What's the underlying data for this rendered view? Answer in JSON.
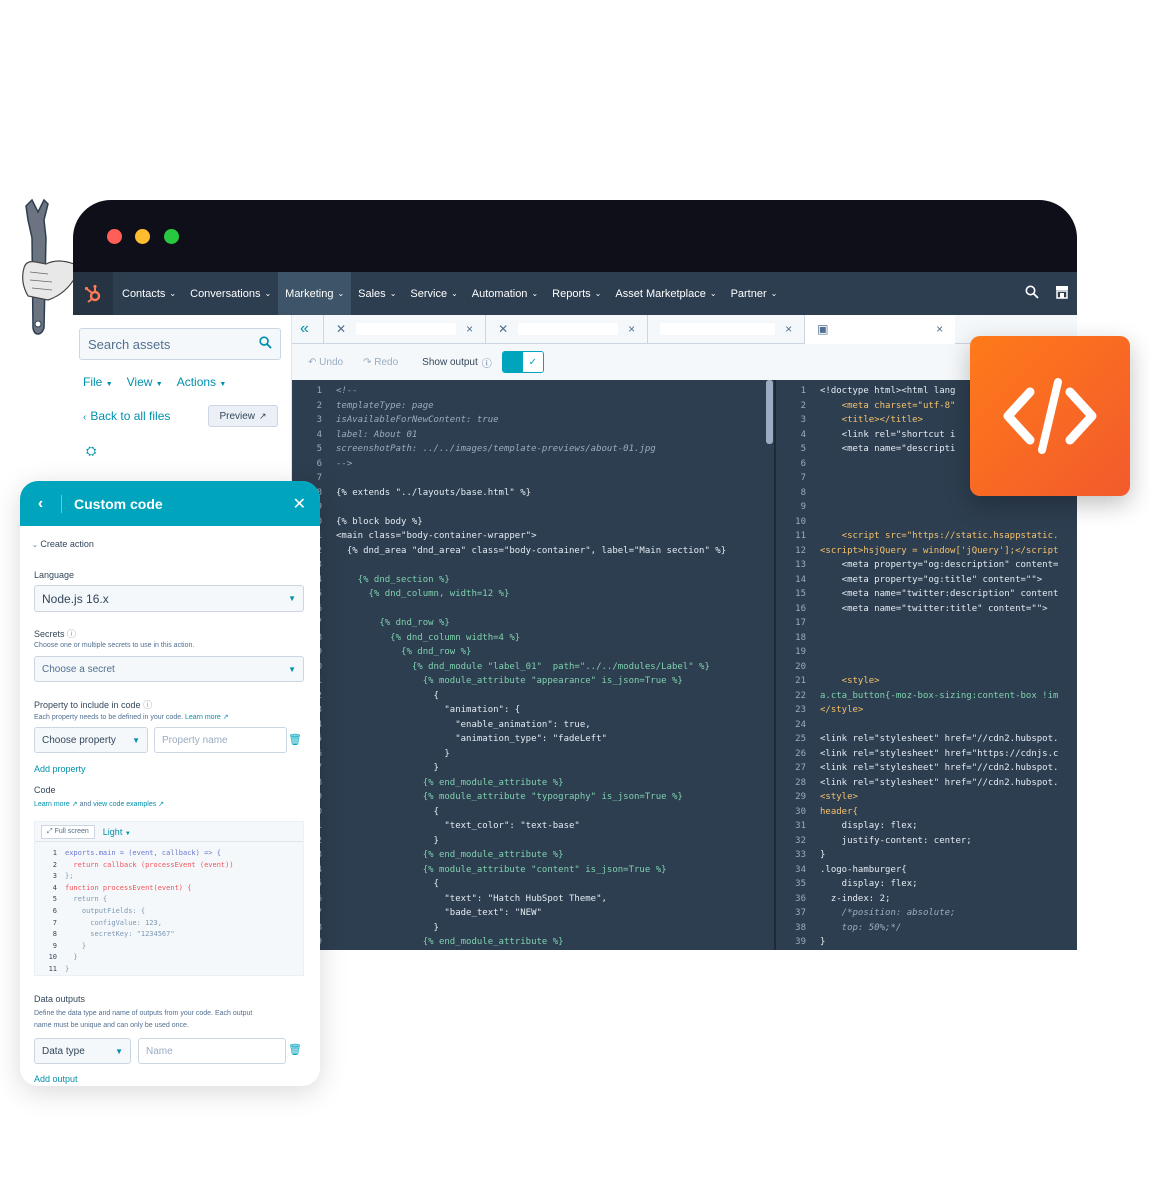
{
  "nav": {
    "items": [
      "Contacts",
      "Conversations",
      "Marketing",
      "Sales",
      "Service",
      "Automation",
      "Reports",
      "Asset Marketplace",
      "Partner"
    ],
    "active": "Marketing",
    "icons": [
      "sprocket-logo-icon",
      "search-icon",
      "marketplace-icon"
    ]
  },
  "assets": {
    "search_placeholder": "Search assets",
    "menus": [
      "File",
      "View",
      "Actions"
    ],
    "back_link": "Back to all files",
    "preview": "Preview"
  },
  "toolbar": {
    "undo": "Undo",
    "redo": "Redo",
    "show_output": "Show output"
  },
  "code_left": [
    {
      "n": "1",
      "t": "<!--",
      "c": "#99acc2",
      "i": true
    },
    {
      "n": "2",
      "t": "templateType: page",
      "c": "#99acc2",
      "i": true
    },
    {
      "n": "3",
      "t": "isAvailableForNewContent: true",
      "c": "#99acc2",
      "i": true
    },
    {
      "n": "4",
      "t": "label: About 01",
      "c": "#99acc2",
      "i": true
    },
    {
      "n": "5",
      "t": "screenshotPath: ../../images/template-previews/about-01.jpg",
      "c": "#99acc2",
      "i": true
    },
    {
      "n": "6",
      "t": "-->",
      "c": "#99acc2",
      "i": true
    },
    {
      "n": "7",
      "t": "",
      "c": "#e4ebf2"
    },
    {
      "n": "8",
      "t": "{% extends \"../layouts/base.html\" %}",
      "c": "#e4ebf2"
    },
    {
      "n": "9",
      "t": "",
      "c": "#e4ebf2"
    },
    {
      "n": "10",
      "t": "{% block body %}",
      "c": "#e4ebf2"
    },
    {
      "n": "11",
      "t": "<main class=\"body-container-wrapper\">",
      "c": "#e4ebf2"
    },
    {
      "n": "12",
      "t": "  {% dnd_area \"dnd_area\" class=\"body-container\", label=\"Main section\" %}",
      "c": "#e4ebf2"
    },
    {
      "n": "13",
      "t": "",
      "c": "#e4ebf2"
    },
    {
      "n": "14",
      "t": "    {% dnd_section %}",
      "c": "#7fd1ae"
    },
    {
      "n": "15",
      "t": "      {% dnd_column, width=12 %}",
      "c": "#7fd1ae"
    },
    {
      "n": "16",
      "t": "",
      "c": "#e4ebf2"
    },
    {
      "n": "17",
      "t": "        {% dnd_row %}",
      "c": "#7fd1ae"
    },
    {
      "n": "18",
      "t": "          {% dnd_column width=4 %}",
      "c": "#7fd1ae"
    },
    {
      "n": "19",
      "t": "            {% dnd_row %}",
      "c": "#7fd1ae"
    },
    {
      "n": "20",
      "t": "              {% dnd_module \"label_01\"  path=\"../../modules/Label\" %}",
      "c": "#7fd1ae"
    },
    {
      "n": "21",
      "t": "                {% module_attribute \"appearance\" is_json=True %}",
      "c": "#7fd1ae"
    },
    {
      "n": "22",
      "t": "                  {",
      "c": "#e4ebf2"
    },
    {
      "n": "23",
      "t": "                    \"animation\": {",
      "c": "#e4ebf2"
    },
    {
      "n": "24",
      "t": "                      \"enable_animation\": true,",
      "c": "#e4ebf2"
    },
    {
      "n": "25",
      "t": "                      \"animation_type\": \"fadeLeft\"",
      "c": "#e4ebf2"
    },
    {
      "n": "26",
      "t": "                    }",
      "c": "#e4ebf2"
    },
    {
      "n": "27",
      "t": "                  }",
      "c": "#e4ebf2"
    },
    {
      "n": "28",
      "t": "                {% end_module_attribute %}",
      "c": "#7fd1ae"
    },
    {
      "n": "29",
      "t": "                {% module_attribute \"typography\" is_json=True %}",
      "c": "#7fd1ae"
    },
    {
      "n": "30",
      "t": "                  {",
      "c": "#e4ebf2"
    },
    {
      "n": "31",
      "t": "                    \"text_color\": \"text-base\"",
      "c": "#e4ebf2"
    },
    {
      "n": "32",
      "t": "                  }",
      "c": "#e4ebf2"
    },
    {
      "n": "33",
      "t": "                {% end_module_attribute %}",
      "c": "#7fd1ae"
    },
    {
      "n": "34",
      "t": "                {% module_attribute \"content\" is_json=True %}",
      "c": "#7fd1ae"
    },
    {
      "n": "35",
      "t": "                  {",
      "c": "#e4ebf2"
    },
    {
      "n": "36",
      "t": "                    \"text\": \"Hatch HubSpot Theme\",",
      "c": "#e4ebf2"
    },
    {
      "n": "37",
      "t": "                    \"bade_text\": \"NEW\"",
      "c": "#e4ebf2"
    },
    {
      "n": "38",
      "t": "                  }",
      "c": "#e4ebf2"
    },
    {
      "n": "39",
      "t": "                {% end_module_attribute %}",
      "c": "#7fd1ae"
    }
  ],
  "code_right": [
    {
      "n": "1",
      "t": "<!doctype html><html lang",
      "c": "#e4ebf2"
    },
    {
      "n": "2",
      "t": "    <meta charset=\"utf-8\"",
      "c": "#f5c26b"
    },
    {
      "n": "3",
      "t": "    <title></title>",
      "c": "#f5c26b"
    },
    {
      "n": "4",
      "t": "    <link rel=\"shortcut i",
      "c": "#e4ebf2"
    },
    {
      "n": "5",
      "t": "    <meta name=\"descripti",
      "c": "#e4ebf2"
    },
    {
      "n": "6",
      "t": "",
      "c": "#e4ebf2"
    },
    {
      "n": "7",
      "t": "",
      "c": "#e4ebf2"
    },
    {
      "n": "8",
      "t": "",
      "c": "#e4ebf2"
    },
    {
      "n": "9",
      "t": "",
      "c": "#e4ebf2"
    },
    {
      "n": "10",
      "t": "",
      "c": "#e4ebf2"
    },
    {
      "n": "11",
      "t": "    <script src=\"https://static.hsappstatic.",
      "c": "#f5c26b"
    },
    {
      "n": "12",
      "t": "<script>hsjQuery = window['jQuery'];</script",
      "c": "#f5c26b"
    },
    {
      "n": "13",
      "t": "    <meta property=\"og:description\" content=",
      "c": "#e4ebf2"
    },
    {
      "n": "14",
      "t": "    <meta property=\"og:title\" content=\"\">",
      "c": "#e4ebf2"
    },
    {
      "n": "15",
      "t": "    <meta name=\"twitter:description\" content",
      "c": "#e4ebf2"
    },
    {
      "n": "16",
      "t": "    <meta name=\"twitter:title\" content=\"\">",
      "c": "#e4ebf2"
    },
    {
      "n": "17",
      "t": "",
      "c": "#e4ebf2"
    },
    {
      "n": "18",
      "t": "",
      "c": "#e4ebf2"
    },
    {
      "n": "19",
      "t": "",
      "c": "#e4ebf2"
    },
    {
      "n": "20",
      "t": "",
      "c": "#e4ebf2"
    },
    {
      "n": "21",
      "t": "    <style>",
      "c": "#f5c26b"
    },
    {
      "n": "22",
      "t": "a.cta_button{-moz-box-sizing:content-box !im",
      "c": "#7fd1ae"
    },
    {
      "n": "23",
      "t": "</style>",
      "c": "#f5c26b"
    },
    {
      "n": "24",
      "t": "",
      "c": "#e4ebf2"
    },
    {
      "n": "25",
      "t": "<link rel=\"stylesheet\" href=\"//cdn2.hubspot.",
      "c": "#e4ebf2"
    },
    {
      "n": "26",
      "t": "<link rel=\"stylesheet\" href=\"https://cdnjs.c",
      "c": "#e4ebf2"
    },
    {
      "n": "27",
      "t": "<link rel=\"stylesheet\" href=\"//cdn2.hubspot.",
      "c": "#e4ebf2"
    },
    {
      "n": "28",
      "t": "<link rel=\"stylesheet\" href=\"//cdn2.hubspot.",
      "c": "#e4ebf2"
    },
    {
      "n": "29",
      "t": "<style>",
      "c": "#f5c26b"
    },
    {
      "n": "30",
      "t": "header{",
      "c": "#f5c26b"
    },
    {
      "n": "31",
      "t": "    display: flex;",
      "c": "#e4ebf2"
    },
    {
      "n": "32",
      "t": "    justify-content: center;",
      "c": "#e4ebf2"
    },
    {
      "n": "33",
      "t": "}",
      "c": "#e4ebf2"
    },
    {
      "n": "34",
      "t": ".logo-hamburger{",
      "c": "#e4ebf2"
    },
    {
      "n": "35",
      "t": "    display: flex;",
      "c": "#e4ebf2"
    },
    {
      "n": "36",
      "t": "  z-index: 2;",
      "c": "#e4ebf2"
    },
    {
      "n": "37",
      "t": "    /*position: absolute;",
      "c": "#99acc2",
      "i": true
    },
    {
      "n": "38",
      "t": "    top: 50%;*/",
      "c": "#99acc2",
      "i": true
    },
    {
      "n": "39",
      "t": "}",
      "c": "#e4ebf2"
    }
  ],
  "panel": {
    "title": "Custom code",
    "create_action": "Create action",
    "language_label": "Language",
    "language_value": "Node.js 16.x",
    "secrets_label": "Secrets",
    "secrets_hint": "Choose one or multiple secrets to use in this action.",
    "secret_placeholder": "Choose a secret",
    "property_label": "Property to include in code",
    "property_hint": "Each property needs to be defined in your code.",
    "learn_more": "Learn more",
    "choose_property": "Choose property",
    "property_name": "Property name",
    "add_property": "Add property",
    "code_label": "Code",
    "and": "and",
    "view_examples": "view code examples",
    "full_screen": "Full screen",
    "theme": "Light",
    "outputs_label": "Data outputs",
    "outputs_hint_1": "Define the data type and name of outputs from your code. Each output",
    "outputs_hint_2": "name must be unique and can only be used once.",
    "data_type": "Data type",
    "name_placeholder": "Name",
    "add_output": "Add output"
  },
  "mini_code": [
    {
      "n": "1",
      "t": "exports.main = (event, callback) => {"
    },
    {
      "n": "2",
      "t": "  return callback (processEvent (event))"
    },
    {
      "n": "3",
      "t": "};"
    },
    {
      "n": "4",
      "t": "function processEvent(event) {"
    },
    {
      "n": "5",
      "t": "  return {"
    },
    {
      "n": "6",
      "t": "    outputFields: {"
    },
    {
      "n": "7",
      "t": "      configValue: 123,"
    },
    {
      "n": "8",
      "t": "      secretKey: \"1234567\""
    },
    {
      "n": "9",
      "t": "    }"
    },
    {
      "n": "10",
      "t": "  }"
    },
    {
      "n": "11",
      "t": "}"
    }
  ],
  "colors": {
    "accent": "#00a4bd",
    "nav": "#2d3e50",
    "editor": "#2d3e50",
    "badge": "#ff7a1a"
  }
}
